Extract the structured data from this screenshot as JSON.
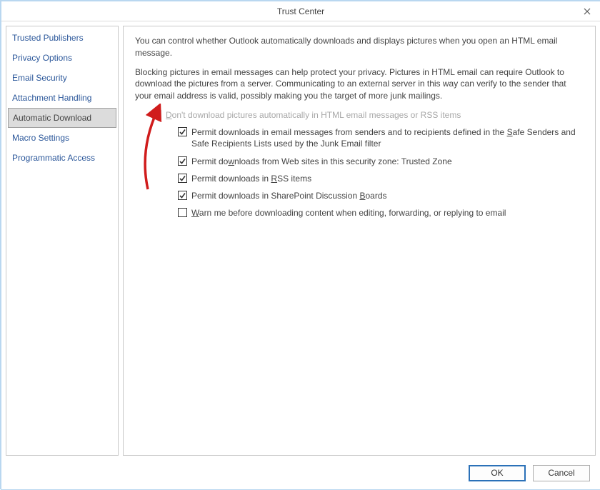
{
  "window": {
    "title": "Trust Center"
  },
  "sidebar": {
    "items": [
      {
        "label": "Trusted Publishers"
      },
      {
        "label": "Privacy Options"
      },
      {
        "label": "Email Security"
      },
      {
        "label": "Attachment Handling"
      },
      {
        "label": "Automatic Download"
      },
      {
        "label": "Macro Settings"
      },
      {
        "label": "Programmatic Access"
      }
    ],
    "selected_index": 4
  },
  "main": {
    "desc1": "You can control whether Outlook automatically downloads and displays pictures when you open an HTML email message.",
    "desc2": "Blocking pictures in email messages can help protect your privacy. Pictures in HTML email can require Outlook to download the pictures from a server. Communicating to an external server in this way can verify to the sender that your email address is valid, possibly making you the target of more junk mailings.",
    "options": {
      "master": {
        "checked": true,
        "disabled": true,
        "pre": "",
        "accel": "D",
        "post": "on't download pictures automatically in HTML email messages or RSS items"
      },
      "subs": [
        {
          "checked": true,
          "pre": "Permit downloads in email messages from senders and to recipients defined in the ",
          "accel": "S",
          "post": "afe Senders and Safe Recipients Lists used by the Junk Email filter"
        },
        {
          "checked": true,
          "pre": "Permit do",
          "accel": "w",
          "post": "nloads from Web sites in this security zone: Trusted Zone"
        },
        {
          "checked": true,
          "pre": "Permit downloads in ",
          "accel": "R",
          "post": "SS items"
        },
        {
          "checked": true,
          "pre": "Permit downloads in SharePoint Discussion ",
          "accel": "B",
          "post": "oards"
        },
        {
          "checked": false,
          "pre": "",
          "accel": "W",
          "post": "arn me before downloading content when editing, forwarding, or replying to email"
        }
      ]
    }
  },
  "buttons": {
    "ok": "OK",
    "cancel": "Cancel"
  }
}
